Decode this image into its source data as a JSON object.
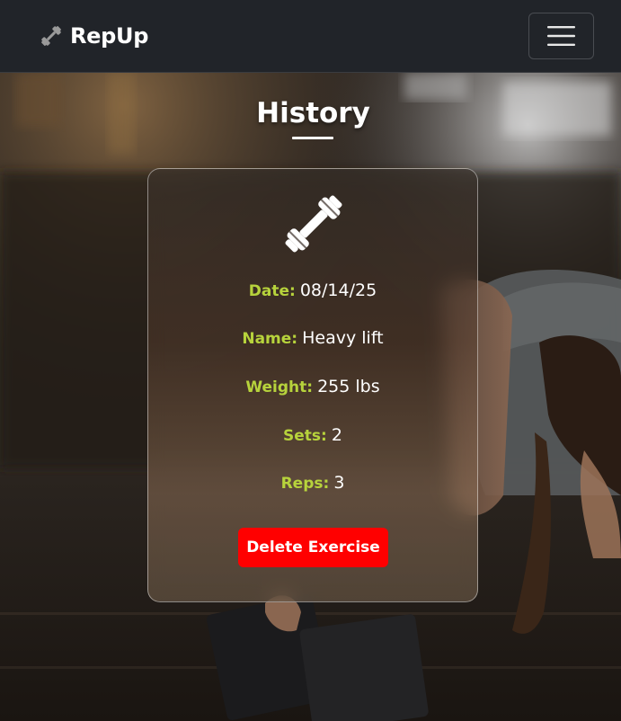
{
  "navbar": {
    "brand": "RepUp",
    "brand_icon": "dumbbell-icon",
    "menu_icon": "hamburger-menu-icon"
  },
  "page": {
    "title": "History"
  },
  "exercise_card": {
    "icon": "dumbbell-icon",
    "date_label": "Date:",
    "date_value": "08/14/25",
    "name_label": "Name:",
    "name_value": "Heavy lift",
    "weight_label": "Weight:",
    "weight_value": "255 lbs",
    "sets_label": "Sets:",
    "sets_value": "2",
    "reps_label": "Reps:",
    "reps_value": "3",
    "delete_label": "Delete Exercise"
  },
  "colors": {
    "navbar_bg": "#212429",
    "label_accent": "#b7d33c",
    "danger": "#ff0000",
    "text": "#ffffff"
  }
}
